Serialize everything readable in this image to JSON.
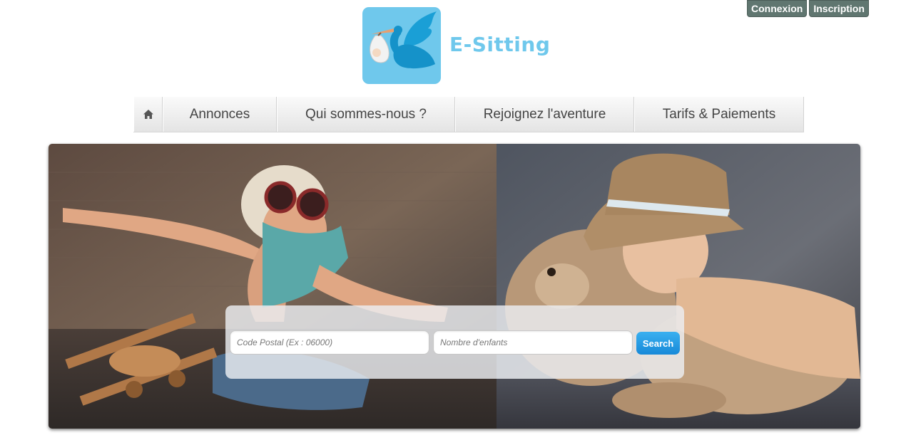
{
  "header": {
    "brand_name": "E-Sitting",
    "auth": {
      "login_label": "Connexion",
      "register_label": "Inscription"
    }
  },
  "nav": {
    "home_icon": "home-icon",
    "items": [
      {
        "label": "Annonces"
      },
      {
        "label": "Qui sommes-nous ?"
      },
      {
        "label": "Rejoignez l'aventure"
      },
      {
        "label": "Tarifs & Paiements"
      }
    ]
  },
  "search": {
    "postal_placeholder": "Code Postal (Ex : 06000)",
    "children_placeholder": "Nombre d'enfants",
    "button_label": "Search"
  },
  "colors": {
    "brand_blue": "#6fc8ec",
    "auth_button": "#607670",
    "search_button": "#1e8fdc"
  }
}
